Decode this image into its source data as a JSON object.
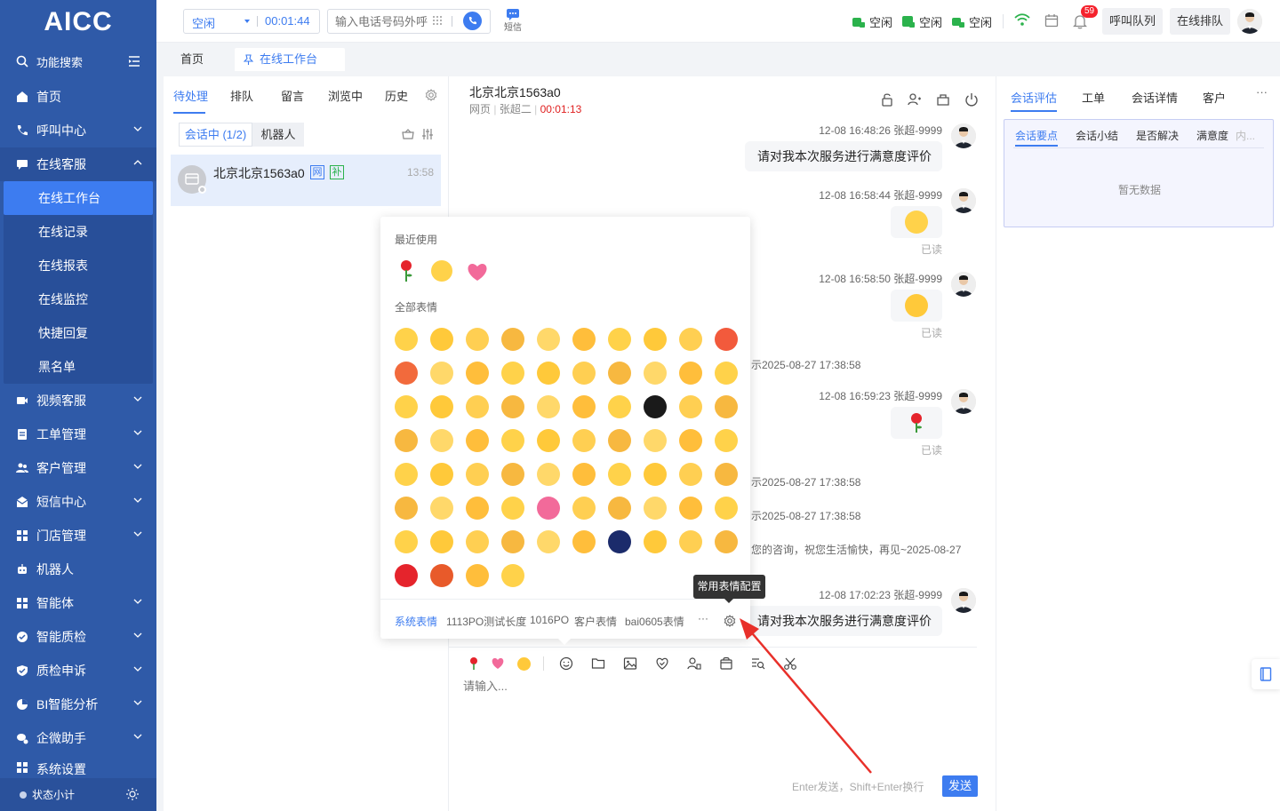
{
  "app": {
    "logo": "AICC"
  },
  "sidebar": {
    "search_label": "功能搜索",
    "items": [
      {
        "label": "首页",
        "icon": "home-icon"
      },
      {
        "label": "呼叫中心",
        "icon": "phone-icon"
      },
      {
        "label": "在线客服",
        "icon": "chat-icon"
      },
      {
        "label": "视频客服",
        "icon": "video-icon"
      },
      {
        "label": "工单管理",
        "icon": "ticket-icon"
      },
      {
        "label": "客户管理",
        "icon": "users-icon"
      },
      {
        "label": "短信中心",
        "icon": "mail-icon"
      },
      {
        "label": "门店管理",
        "icon": "store-icon"
      },
      {
        "label": "机器人",
        "icon": "robot-icon"
      },
      {
        "label": "智能体",
        "icon": "agent-icon"
      },
      {
        "label": "智能质检",
        "icon": "quality-icon"
      },
      {
        "label": "质检申诉",
        "icon": "shield-icon"
      },
      {
        "label": "BI智能分析",
        "icon": "pie-icon"
      },
      {
        "label": "企微助手",
        "icon": "wecom-icon"
      },
      {
        "label": "系统设置",
        "icon": "settings-grid-icon"
      }
    ],
    "subitems": [
      "在线工作台",
      "在线记录",
      "在线报表",
      "在线监控",
      "快捷回复",
      "黑名单"
    ],
    "footer": "状态小计"
  },
  "topbar": {
    "status_select": "空闲",
    "timer": "00:01:44",
    "phone_placeholder": "输入电话号码外呼",
    "sms_label": "短信",
    "queue_statuses": [
      "空闲",
      "空闲",
      "空闲"
    ],
    "notification_count": "59",
    "call_queue_btn": "呼叫队列",
    "online_queue_btn": "在线排队"
  },
  "page_tabs": [
    {
      "label": "首页"
    },
    {
      "label": "在线工作台"
    }
  ],
  "list_panel": {
    "tabs": [
      "待处理",
      "排队",
      "留言",
      "浏览中",
      "历史"
    ],
    "subtabs": [
      "会话中 (1/2)",
      "机器人"
    ],
    "session": {
      "name": "北京北京1563a0",
      "badge1": "网",
      "badge2": "补",
      "time": "13:58"
    }
  },
  "chat": {
    "title": "北京北京1563a0",
    "source": "网页",
    "agent": "张超二",
    "duration": "00:01:13",
    "messages": [
      {
        "meta": "12-08 16:48:26 张超-9999",
        "text": "请对我本次服务进行满意度评价"
      },
      {
        "meta": "12-08 16:58:44 张超-9999",
        "read": "已读"
      },
      {
        "meta": "12-08 16:58:50 张超-9999",
        "read": "已读"
      },
      {
        "meta": "12-08 16:59:23 张超-9999",
        "read": "已读"
      },
      {
        "meta": "12-08 17:02:23 张超-9999",
        "text": "请对我本次服务进行满意度评价"
      }
    ],
    "system_lines": [
      "示2025-08-27 17:38:58",
      "示2025-08-27 17:38:58",
      "示2025-08-27 17:38:58",
      "您的咨询，祝您生活愉快，再见~2025-08-27"
    ],
    "input_placeholder": "请输入...",
    "send_hint": "Enter发送，Shift+Enter换行",
    "send_btn": "发送"
  },
  "emoji_popup": {
    "recent_title": "最近使用",
    "all_title": "全部表情",
    "tabs": [
      "系统表情",
      "1113PO测试长度",
      "1016PO",
      "客户表情",
      "bai0605表情"
    ],
    "more": "···",
    "tooltip": "常用表情配置"
  },
  "right_panel": {
    "tabs": [
      "会话评估",
      "工单",
      "会话详情",
      "客户"
    ],
    "more": "···",
    "subtabs": [
      "会话要点",
      "会话小结",
      "是否解决",
      "满意度",
      "内..."
    ],
    "empty": "暂无数据"
  },
  "colors": {
    "sidebar": "#2f5aa8",
    "accent": "#3d7cf0",
    "timer_red": "#e02020",
    "green": "#2bb24c"
  }
}
